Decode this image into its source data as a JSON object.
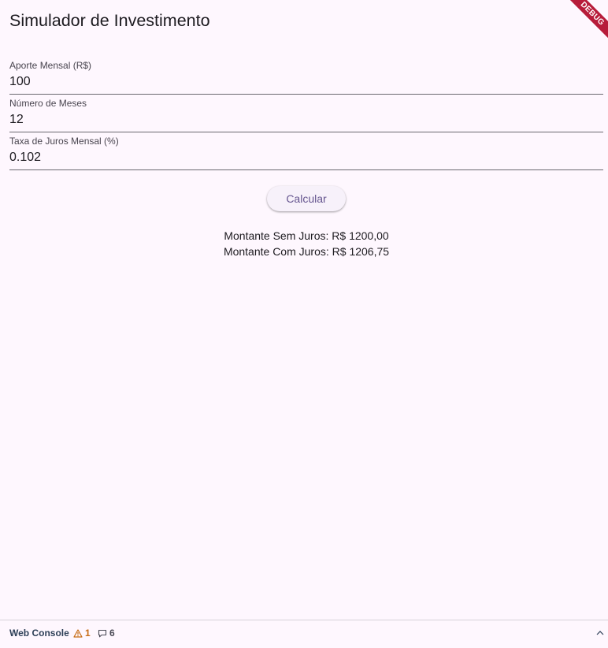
{
  "app": {
    "title": "Simulador de Investimento",
    "debug_label": "DEBUG"
  },
  "fields": [
    {
      "label": "Aporte Mensal (R$)",
      "value": "100"
    },
    {
      "label": "Número de Meses",
      "value": "12"
    },
    {
      "label": "Taxa de Juros Mensal (%)",
      "value": "0.102"
    }
  ],
  "actions": {
    "calculate_label": "Calcular"
  },
  "results": {
    "without_interest": "Montante Sem Juros: R$ 1200,00",
    "with_interest": "Montante Com Juros: R$ 1206,75"
  },
  "console": {
    "title": "Web Console",
    "warning_count": "1",
    "message_count": "6",
    "warning_icon": "warning-triangle-icon",
    "message_icon": "speech-bubble-icon",
    "toggle_icon": "chevron-up-icon"
  },
  "colors": {
    "background": "#fef7fe",
    "primary": "#65558f",
    "debug_banner": "#b71c3a",
    "warning": "#c76b13"
  }
}
